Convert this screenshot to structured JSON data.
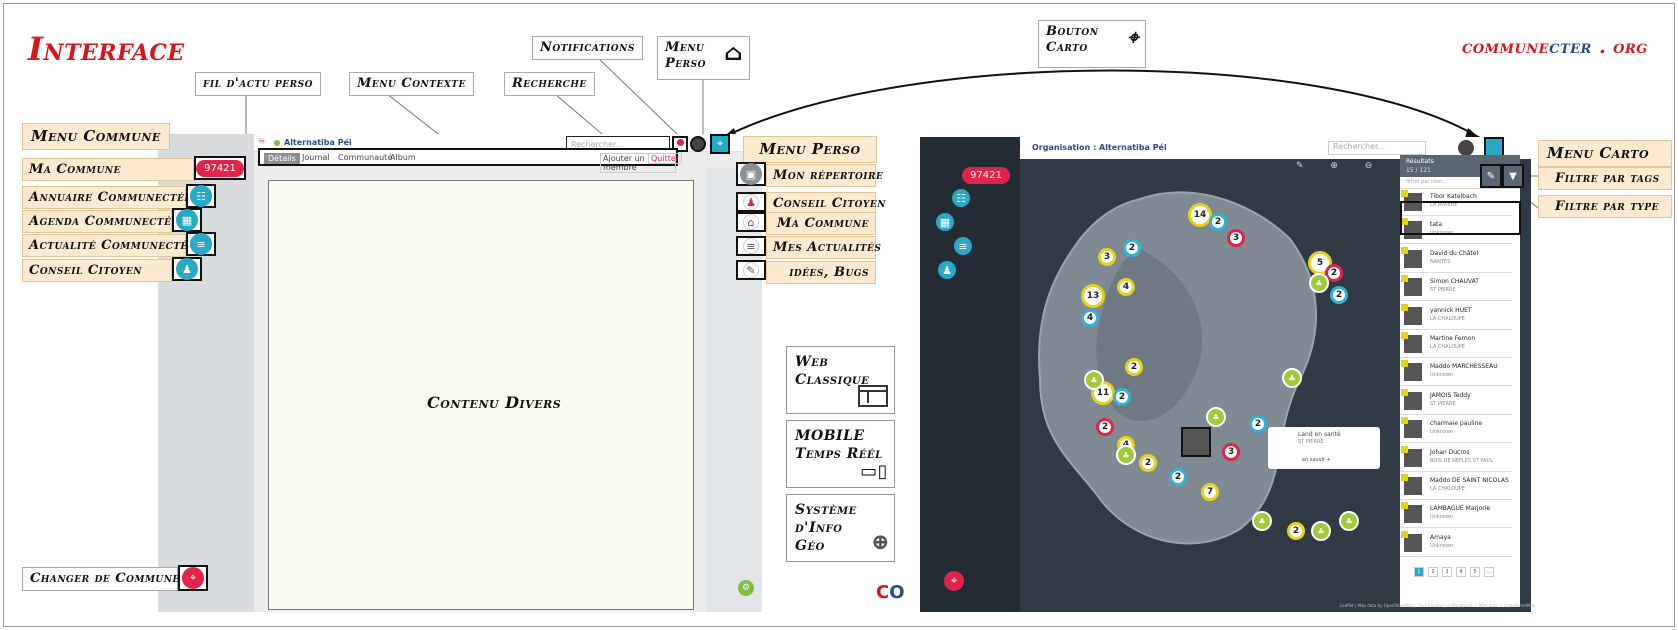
{
  "title": "Interface",
  "logo": {
    "part1": "commune",
    "part2": "cter",
    "part3": " . org"
  },
  "labels": {
    "fil_actu": "fil d'actu perso",
    "menu_contexte": "Menu Contexte",
    "recherche": "Recherche",
    "notifications": "Notifications",
    "menu_perso": "Menu Perso",
    "bouton_carto": "Bouton Carto",
    "contenu_divers": "Contenu Divers"
  },
  "left_menu": {
    "header": "Menu Commune",
    "items": [
      {
        "label": "Ma Commune",
        "badge": "97421"
      },
      {
        "label": "Annuaire Communectée"
      },
      {
        "label": "Agenda Communecté"
      },
      {
        "label": "Actualité Communectée"
      },
      {
        "label": "Conseil Citoyen"
      }
    ],
    "change": "Changer de Commune"
  },
  "app_left": {
    "topbar_title": "Alternatiba Péi",
    "search_placeholder": "Rechercher...",
    "tabs": [
      "Détails",
      "Journal",
      "Communauté",
      "Album"
    ],
    "actions": [
      "Ajouter un membre",
      "Quitter"
    ]
  },
  "right_menu": {
    "header": "Menu Perso",
    "items": [
      "Mon répertoire",
      "Conseil Citoyen",
      "Ma Commune",
      "Mes Actualités",
      "idées, Bugs"
    ]
  },
  "mode_cards": [
    {
      "label": "Web Classique",
      "icon": "layout-icon"
    },
    {
      "label": "MOBILE Temps Réél",
      "icon": "devices-icon"
    },
    {
      "label": "Système d'Info Géo",
      "icon": "world-map-icon"
    }
  ],
  "app_right": {
    "topbar_title": "Organisation : Alternatiba Péi",
    "badge": "97421",
    "search_placeholder": "Rechercher...",
    "results_title": "Résultats",
    "results_count": "15 / 121",
    "filter_placeholder": "filtrer par nom...",
    "list": [
      {
        "name": "Tibor Katelbach",
        "sub": "LA RIVIERE"
      },
      {
        "name": "tata",
        "sub": "Unknown"
      },
      {
        "name": "David du Châtel",
        "sub": "NANTES"
      },
      {
        "name": "Simon CHAUVAT",
        "sub": "ST PIERRE"
      },
      {
        "name": "yannick HUET",
        "sub": "LA CHALOUPE"
      },
      {
        "name": "Martine Fernon",
        "sub": "LA CHALOUPE"
      },
      {
        "name": "Maddo MARCHESSEAU",
        "sub": "Unknown"
      },
      {
        "name": "JAMOIS Teddy",
        "sub": "ST PIERRE"
      },
      {
        "name": "charmaie pauline",
        "sub": "Unknown"
      },
      {
        "name": "Johan Ducros",
        "sub": "BOIS DE NEFLES ST PAUL"
      },
      {
        "name": "Maddo DE SAINT NICOLAS",
        "sub": "LA CHALOUPE"
      },
      {
        "name": "LAMBAGUE Marjorie",
        "sub": "Unknown"
      },
      {
        "name": "Amaya",
        "sub": "Unknown"
      }
    ],
    "pages": [
      "1",
      "2",
      "3",
      "4",
      "5",
      "..."
    ],
    "popup": {
      "title": "Land en santé",
      "sub": "ST PIERRE",
      "link": "en savoir +"
    },
    "clusters": [
      "14",
      "2",
      "3",
      "3",
      "2",
      "5",
      "2",
      "2",
      "13",
      "4",
      "4",
      "2",
      "11",
      "2",
      "2",
      "2",
      "2",
      "7",
      "3",
      "2",
      "2",
      "4"
    ],
    "attribution": "Leaflet | Map data by OpenStreetMap, Tiles Courtesy of MapQuest — Map data © OpenStreetMap"
  },
  "carto_menu": {
    "header": "Menu Carto",
    "filters": [
      "Filtre par tags",
      "Filtre par type"
    ]
  },
  "colors": {
    "accent_red": "#d8141c",
    "cyan": "#28a9c6",
    "tag_bg": "#fde9cf",
    "map_dark": "#2f3a44"
  }
}
